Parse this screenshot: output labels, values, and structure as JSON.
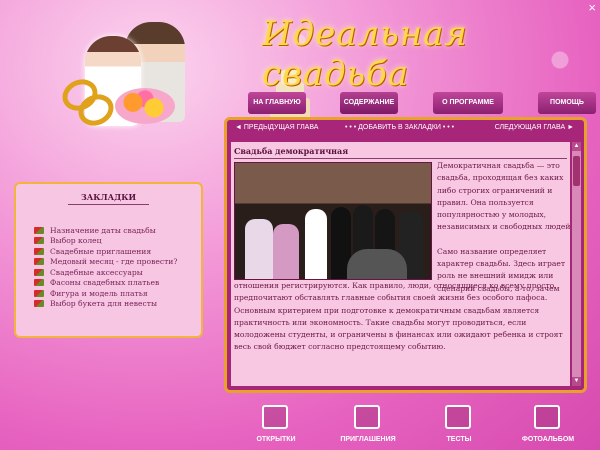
{
  "window": {
    "close_label": "×"
  },
  "header": {
    "title": "Идеальная свадьба"
  },
  "nav": {
    "items": [
      {
        "label": "НА ГЛАВНУЮ"
      },
      {
        "label": "СОДЕРЖАНИЕ"
      },
      {
        "label": "О ПРОГРАММЕ"
      },
      {
        "label": "ПОМОЩЬ"
      }
    ]
  },
  "chapter_bar": {
    "prev_label": "◄ ПРЕДЫДУЩАЯ ГЛАВА",
    "bookmark_label": "• • • ДОБАВИТЬ В ЗАКЛАДКИ • • •",
    "next_label": "СЛЕДУЮЩАЯ ГЛАВА ►"
  },
  "article": {
    "title": "Свадьба демократичная",
    "paragraph1": "Демократичная свадьба — это свадьба, проходящая без каких либо строгих ограничений и правил. Она пользуется популярностью у молодых, независимых и свободных людей.",
    "paragraph2_start": "Само название определяет характер свадьбы. Здесь играет роль не внешний имидж или сценарий свадьбы, а то, зачем",
    "paragraph2_rest": "отношения регистрируются. Как правило, люди, относящиеся ко всему просто, предпочитают обставлять главные события своей жизни без особого пафоса. Основным критерием при подготовке к демократичным свадьбам является практичность или экономность. Такие свадьбы могут проводиться, если молодожены студенты, и ограничены в финансах или ожидают ребенка и строят весь свой бюджет согласно предстоящему событию."
  },
  "bookmarks": {
    "title": "ЗАКЛАДКИ",
    "items": [
      "Назначение даты свадьбы",
      "Выбор колец",
      "Свадебные приглашения",
      "Медовый месяц - где провести?",
      "Свадебные аксессуары",
      "Фасоны свадебных платьев",
      "Фигура и модель платья",
      "Выбор букета для невесты"
    ]
  },
  "toolbar": {
    "items": [
      {
        "label": "ОТКРЫТКИ",
        "icon": "postcard-icon"
      },
      {
        "label": "ПРИГЛАШЕНИЯ",
        "icon": "invitation-icon"
      },
      {
        "label": "ТЕСТЫ",
        "icon": "tests-icon"
      },
      {
        "label": "ФОТОАЛЬБОМ",
        "icon": "photo-album-icon"
      }
    ]
  },
  "colors": {
    "accent": "#e8a12a",
    "title": "#ffd84a",
    "text": "#6b1747",
    "panel": "#a8267a"
  }
}
